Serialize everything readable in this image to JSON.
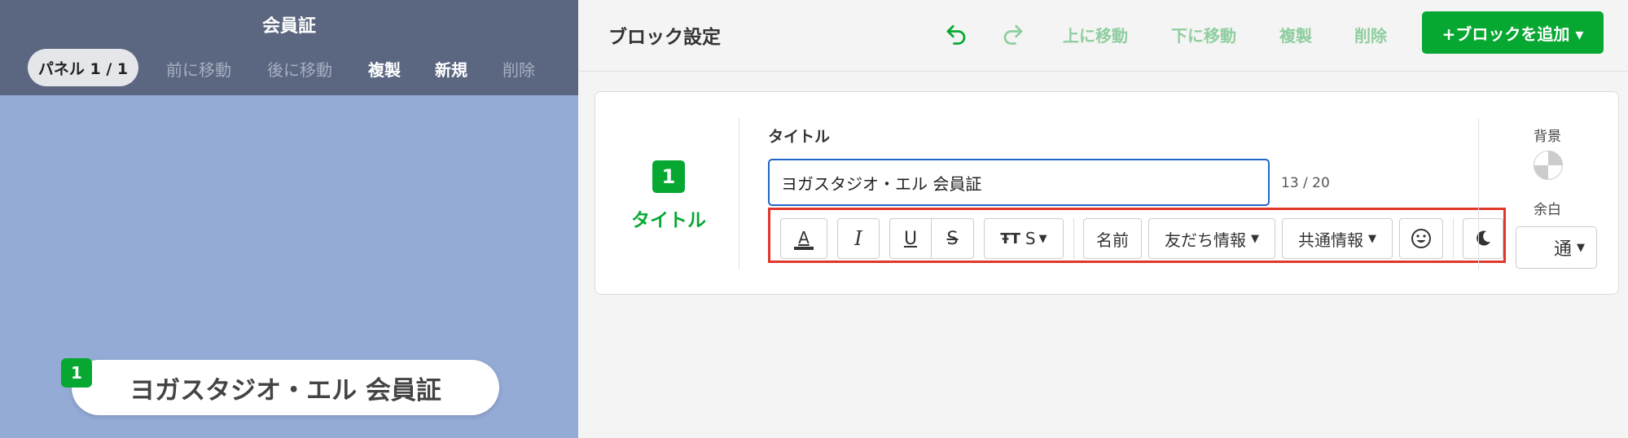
{
  "left": {
    "title": "会員証",
    "panel_pill": "パネル 1 / 1",
    "buttons": [
      "前に移動",
      "後に移動",
      "複製",
      "新規",
      "削除"
    ],
    "preview": {
      "number": "1",
      "text": "ヨガスタジオ・エル 会員証"
    }
  },
  "header": {
    "title": "ブロック設定",
    "undo_icon": "undo-icon",
    "redo_icon": "redo-icon",
    "buttons": [
      "上に移動",
      "下に移動",
      "複製",
      "削除"
    ],
    "add_label": "+ブロックを追加 ▾"
  },
  "block": {
    "number": "1",
    "label": "タイトル",
    "field_label": "タイトル",
    "input_value": "ヨガスタジオ・エル 会員証",
    "counter": "13 / 20",
    "toolbar": {
      "font_size": "S",
      "name": "名前",
      "friend_info": "友だち情報",
      "common_info": "共通情報",
      "icons": [
        "text-color-icon",
        "italic-icon",
        "underline-icon",
        "strikethrough-icon",
        "font-size-icon",
        "emoji-icon",
        "moon-icon"
      ]
    },
    "side": {
      "background_label": "背景",
      "margin_label": "余白",
      "margin_value": "通"
    }
  },
  "colors": {
    "accent": "#07a832",
    "focus": "#1f67c7",
    "highlight": "#e1372b",
    "left_header": "#5b6681",
    "left_bg": "#94abd6"
  }
}
